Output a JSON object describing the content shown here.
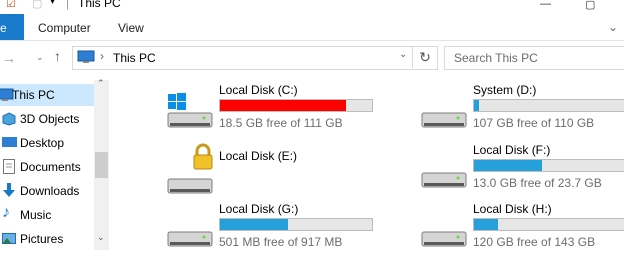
{
  "window": {
    "title": "This PC"
  },
  "ribbon": {
    "file_label": "e",
    "tabs": [
      "Computer",
      "View"
    ]
  },
  "address": {
    "crumb": "This PC"
  },
  "search": {
    "placeholder": "Search This PC"
  },
  "nav_pane": {
    "items": [
      {
        "label": "This PC",
        "icon": "pc-icon",
        "selected": true
      },
      {
        "label": "3D Objects",
        "icon": "3d-objects-icon"
      },
      {
        "label": "Desktop",
        "icon": "desktop-icon"
      },
      {
        "label": "Documents",
        "icon": "documents-icon"
      },
      {
        "label": "Downloads",
        "icon": "downloads-icon"
      },
      {
        "label": "Music",
        "icon": "music-icon"
      },
      {
        "label": "Pictures",
        "icon": "pictures-icon"
      }
    ]
  },
  "drives": [
    {
      "name": "Local Disk (C:)",
      "free_text": "18.5 GB free of 111 GB",
      "used_fraction": 0.83,
      "bar_color": "#ff0000",
      "badge": "windows-logo"
    },
    {
      "name": "System (D:)",
      "free_text": "107 GB free of 110 GB",
      "used_fraction": 0.03,
      "bar_color": "#26a0da"
    },
    {
      "name": "Local Disk (E:)",
      "free_text": "",
      "used_fraction": null,
      "bar_color": "#26a0da",
      "badge": "lock"
    },
    {
      "name": "Local Disk (F:)",
      "free_text": "13.0 GB free of 23.7 GB",
      "used_fraction": 0.45,
      "bar_color": "#26a0da"
    },
    {
      "name": "Local Disk (G:)",
      "free_text": "501 MB free of 917 MB",
      "used_fraction": 0.45,
      "bar_color": "#26a0da"
    },
    {
      "name": "Local Disk (H:)",
      "free_text": "120 GB free of 143 GB",
      "used_fraction": 0.16,
      "bar_color": "#26a0da"
    }
  ]
}
